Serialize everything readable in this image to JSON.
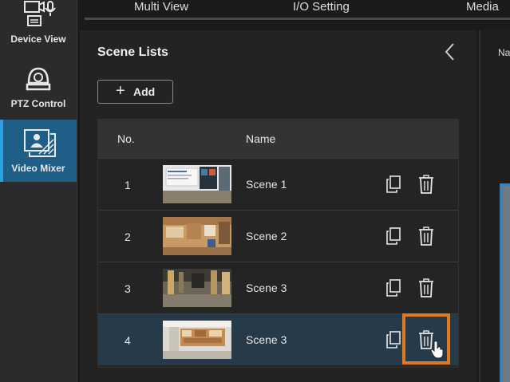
{
  "nav": {
    "items": [
      {
        "label": "Device View",
        "icon": "camera-mic-icon"
      },
      {
        "label": "PTZ Control",
        "icon": "ptz-camera-icon"
      },
      {
        "label": "Video Mixer",
        "icon": "video-mixer-icon",
        "active": true
      }
    ]
  },
  "tabs": [
    "Multi View",
    "I/O Setting",
    "Media"
  ],
  "panel": {
    "title": "Scene Lists",
    "add_label": "Add",
    "columns": {
      "no": "No.",
      "name": "Name"
    },
    "rows": [
      {
        "no": "1",
        "name": "Scene 1",
        "thumbnail": "scene-1-thumbnail"
      },
      {
        "no": "2",
        "name": "Scene 2",
        "thumbnail": "scene-2-thumbnail"
      },
      {
        "no": "3",
        "name": "Scene 3",
        "thumbnail": "scene-3-thumbnail"
      },
      {
        "no": "4",
        "name": "Scene 3",
        "thumbnail": "scene-4-thumbnail",
        "selected": true
      }
    ]
  },
  "right_panel": {
    "label": "Na"
  },
  "colors": {
    "accent": "#2fa0e0",
    "highlight": "#e07820",
    "selected_row": "#273a4a"
  }
}
